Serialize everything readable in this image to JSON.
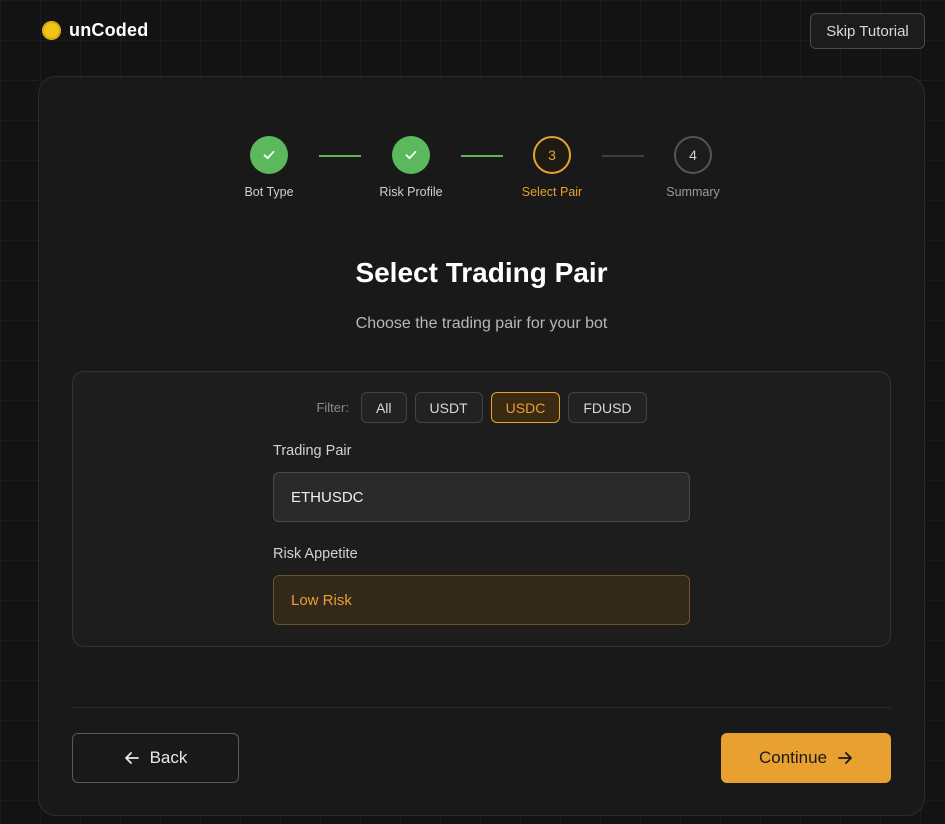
{
  "brand": {
    "name": "unCoded"
  },
  "header": {
    "skip_label": "Skip Tutorial"
  },
  "stepper": {
    "steps": [
      {
        "label": "Bot Type",
        "status": "done",
        "number": "1"
      },
      {
        "label": "Risk Profile",
        "status": "done",
        "number": "2"
      },
      {
        "label": "Select Pair",
        "status": "active",
        "number": "3"
      },
      {
        "label": "Summary",
        "status": "todo",
        "number": "4"
      }
    ]
  },
  "main": {
    "title": "Select Trading Pair",
    "subtitle": "Choose the trading pair for your bot"
  },
  "filter": {
    "label": "Filter:",
    "options": [
      "All",
      "USDT",
      "USDC",
      "FDUSD"
    ],
    "selected": "USDC"
  },
  "form": {
    "pair_label": "Trading Pair",
    "pair_value": "ETHUSDC",
    "risk_label": "Risk Appetite",
    "risk_value": "Low Risk"
  },
  "footer": {
    "back_label": "Back",
    "continue_label": "Continue"
  },
  "colors": {
    "accent": "#e8a030",
    "success": "#5cb85c",
    "background": "#131313",
    "brand_dot": "#f0c419"
  },
  "icons": {
    "check": "check-icon",
    "back": "arrow-left-icon",
    "continue": "arrow-right-icon",
    "brand": "brand-dot-icon"
  }
}
